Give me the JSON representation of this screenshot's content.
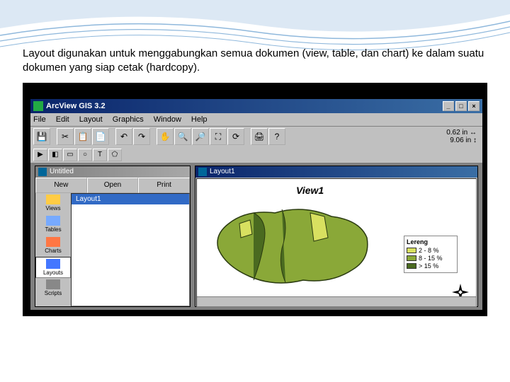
{
  "slide": {
    "desc": "Layout digunakan untuk menggabungkan semua dokumen (view, table, dan chart) ke dalam suatu dokumen\nyang siap cetak (hardcopy)."
  },
  "app": {
    "title": "ArcView GIS 3.2",
    "menus": [
      "File",
      "Edit",
      "Layout",
      "Graphics",
      "Window",
      "Help"
    ],
    "coords_top": "0.62 in",
    "coords_bottom": "9.06 in",
    "toolbar1": {
      "save": "💾",
      "cut": "✂",
      "copy": "📋",
      "paste": "📄",
      "undo": "↶",
      "redo": "↷",
      "pan": "✋",
      "zoom": "🔍",
      "zoomout": "🔎",
      "fit": "⛶",
      "refresh": "⟳",
      "print": "🖨",
      "help": "?"
    },
    "toolbar2": {
      "pointer": "▶",
      "pixel": "◧",
      "text": "T",
      "rect": "▭",
      "circle": "○",
      "poly": "⬠"
    },
    "project": {
      "title": "Untitled",
      "btn_new": "New",
      "btn_open": "Open",
      "btn_print": "Print",
      "side": {
        "views": "Views",
        "tables": "Tables",
        "charts": "Charts",
        "layouts": "Layouts",
        "scripts": "Scripts"
      },
      "list_item": "Layout1"
    },
    "layout": {
      "title": "Layout1",
      "view_label": "View1",
      "legend": {
        "title": "Lereng",
        "rows": [
          {
            "label": "2 - 8 %",
            "color": "#d8e060"
          },
          {
            "label": "8 - 15 %",
            "color": "#8aa838"
          },
          {
            "label": "> 15 %",
            "color": "#4a6a20"
          }
        ]
      }
    }
  }
}
